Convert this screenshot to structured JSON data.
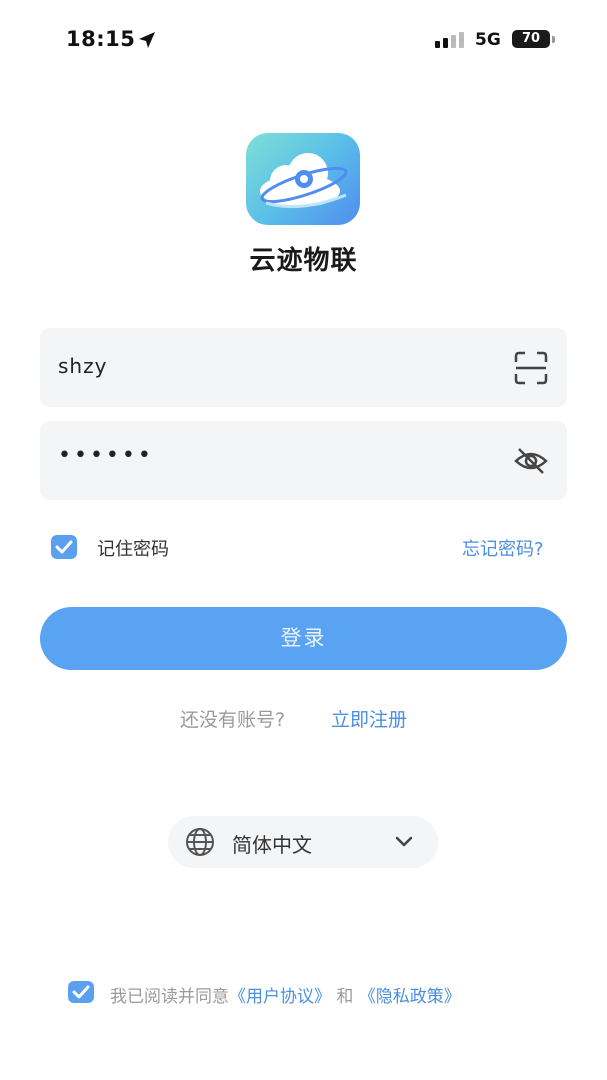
{
  "status_bar": {
    "time": "18:15",
    "network": "5G",
    "battery": "70",
    "location_icon": "location-arrow-icon",
    "signal_icon": "signal-bars-icon"
  },
  "app": {
    "name": "云迹物联",
    "logo_icon": "cloud-logo-icon"
  },
  "login_form": {
    "username": "shzy",
    "password_masked": "••••••",
    "scan_icon": "scan-icon",
    "visibility_icon": "eye-off-icon",
    "remember_checked": true,
    "remember_label": "记住密码",
    "forgot_label": "忘记密码?",
    "login_label": "登录"
  },
  "register": {
    "prompt": "还没有账号?",
    "link": "立即注册"
  },
  "language": {
    "selected": "简体中文"
  },
  "agreement": {
    "checked": true,
    "prefix": "我已阅读并同意",
    "user_agreement": "《用户协议》",
    "and": "和",
    "privacy_policy": "《隐私政策》"
  },
  "colors": {
    "accent": "#5aa2f2",
    "link": "#4a8fe0",
    "field_bg": "#f4f5f7"
  }
}
